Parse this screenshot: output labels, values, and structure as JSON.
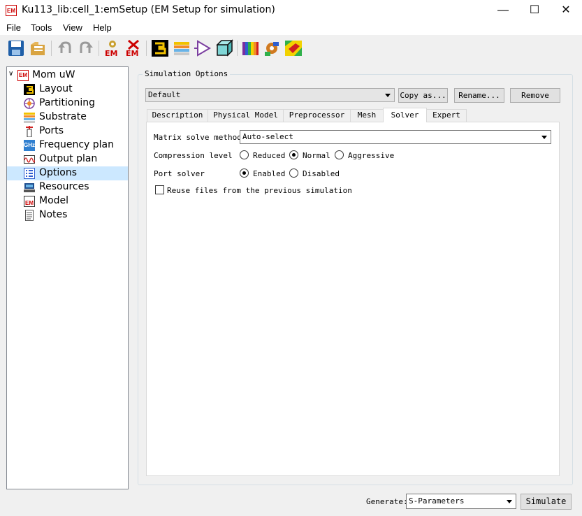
{
  "window": {
    "app_icon_text": "EM",
    "title": "Ku113_lib:cell_1:emSetup (EM Setup for simulation)",
    "controls": {
      "minimize": "—",
      "maximize": "☐",
      "close": "✕"
    }
  },
  "menu": [
    "File",
    "Tools",
    "View",
    "Help"
  ],
  "toolbar": {
    "icons": [
      "save-icon",
      "open-icon",
      "undo-icon",
      "redo-icon",
      "em-settings-icon",
      "em-delete-icon",
      "layout-icon",
      "substrate-icon",
      "port-triangle-icon",
      "box-3d-icon",
      "colormap-icon",
      "mesh-tool-icon",
      "visualization-icon"
    ],
    "labels": {
      "em": "EM"
    }
  },
  "tree": {
    "root": {
      "icon_text": "EM",
      "label": "Mom uW"
    },
    "items": [
      {
        "label": "Layout",
        "icon": "layout-icon"
      },
      {
        "label": "Partitioning",
        "icon": "partitioning-icon"
      },
      {
        "label": "Substrate",
        "icon": "substrate-icon"
      },
      {
        "label": "Ports",
        "icon": "ports-icon"
      },
      {
        "label": "Frequency plan",
        "icon": "frequency-icon",
        "icon_text": "GHz"
      },
      {
        "label": "Output plan",
        "icon": "output-plan-icon"
      },
      {
        "label": "Options",
        "icon": "options-icon",
        "selected": true
      },
      {
        "label": "Resources",
        "icon": "resources-icon"
      },
      {
        "label": "Model",
        "icon": "model-icon",
        "icon_text": "EM"
      },
      {
        "label": "Notes",
        "icon": "notes-icon"
      }
    ]
  },
  "sim_options": {
    "group_title": "Simulation Options",
    "preset_value": "Default",
    "copy_label": "Copy as...",
    "rename_label": "Rename...",
    "remove_label": "Remove"
  },
  "tabs": [
    {
      "label": "Description"
    },
    {
      "label": "Physical Model"
    },
    {
      "label": "Preprocessor"
    },
    {
      "label": "Mesh"
    },
    {
      "label": "Solver",
      "active": true
    },
    {
      "label": "Expert"
    }
  ],
  "solver": {
    "matrix_label": "Matrix solve method",
    "matrix_value": "Auto-select",
    "compression_label": "Compression level",
    "compression_options": [
      "Reduced",
      "Normal",
      "Aggressive"
    ],
    "compression_selected": "Normal",
    "port_solver_label": "Port solver",
    "port_solver_options": [
      "Enabled",
      "Disabled"
    ],
    "port_solver_selected": "Enabled",
    "reuse_label": "Reuse files from the previous simulation",
    "reuse_checked": false
  },
  "footer": {
    "generate_label": "Generate:",
    "generate_value": "S-Parameters",
    "simulate_label": "Simulate"
  }
}
